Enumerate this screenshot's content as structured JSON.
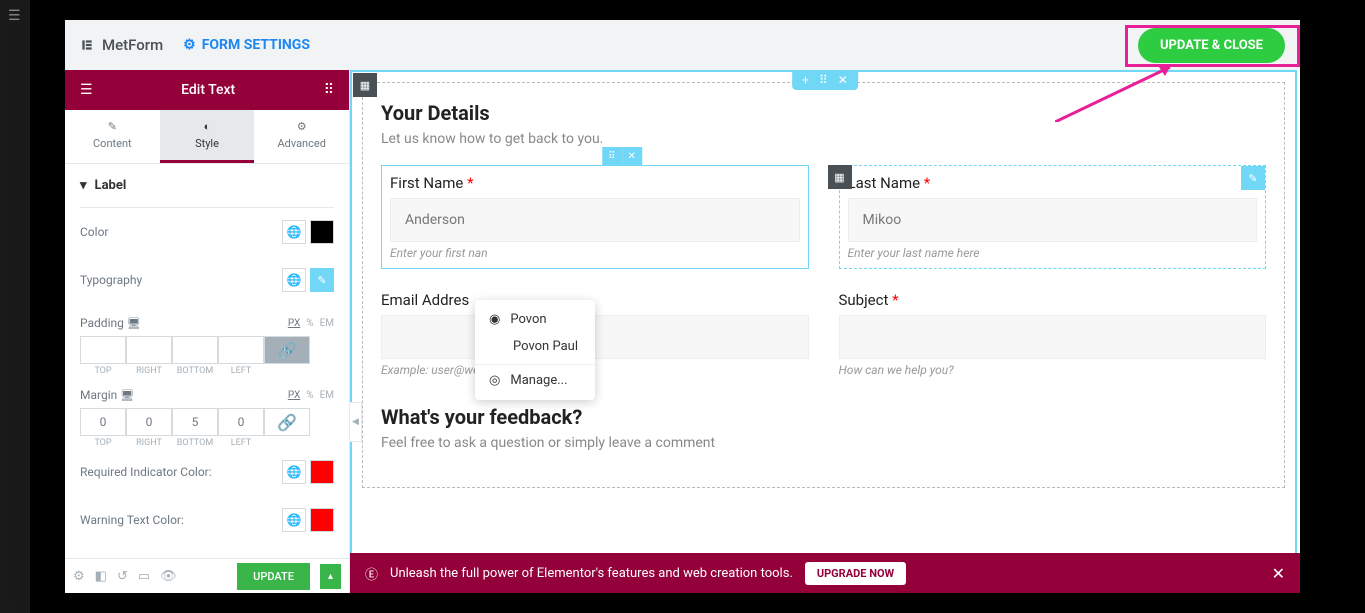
{
  "header": {
    "brand": "MetForm",
    "settings": "FORM SETTINGS",
    "update_close": "UPDATE & CLOSE"
  },
  "sidebar": {
    "title": "Edit Text",
    "tabs": {
      "content": "Content",
      "style": "Style",
      "advanced": "Advanced"
    },
    "section": "Label",
    "controls": {
      "color": "Color",
      "typography": "Typography",
      "padding": "Padding",
      "margin": "Margin",
      "req_color": "Required Indicator Color:",
      "warn_color": "Warning Text Color:"
    },
    "units": {
      "px": "PX",
      "pct": "%",
      "em": "EM"
    },
    "dim_labels": {
      "top": "TOP",
      "right": "RIGHT",
      "bottom": "BOTTOM",
      "left": "LEFT"
    },
    "margin_vals": {
      "top": "0",
      "right": "0",
      "bottom": "5",
      "left": "0"
    },
    "colors": {
      "black": "#000000",
      "red": "#ff0000"
    }
  },
  "footer": {
    "update": "UPDATE"
  },
  "form": {
    "section1": {
      "title": "Your Details",
      "sub": "Let us know how to get back to you."
    },
    "first": {
      "label": "First Name ",
      "value": "Anderson",
      "help": "Enter your first nan"
    },
    "last": {
      "label": "Last Name ",
      "value": "Mikoo",
      "help": "Enter your last name here"
    },
    "email": {
      "label": "Email Addres",
      "help": "Example: user@website.com"
    },
    "subject": {
      "label": "Subject ",
      "help": "How can we help you?"
    },
    "section2": {
      "title": "What's your feedback?",
      "sub": "Feel free to ask a question or simply leave a comment"
    }
  },
  "autofill": {
    "opt1": "Povon",
    "opt2": "Povon Paul",
    "manage": "Manage..."
  },
  "banner": {
    "text": "Unleash the full power of Elementor's features and web creation tools.",
    "btn": "UPGRADE NOW"
  }
}
